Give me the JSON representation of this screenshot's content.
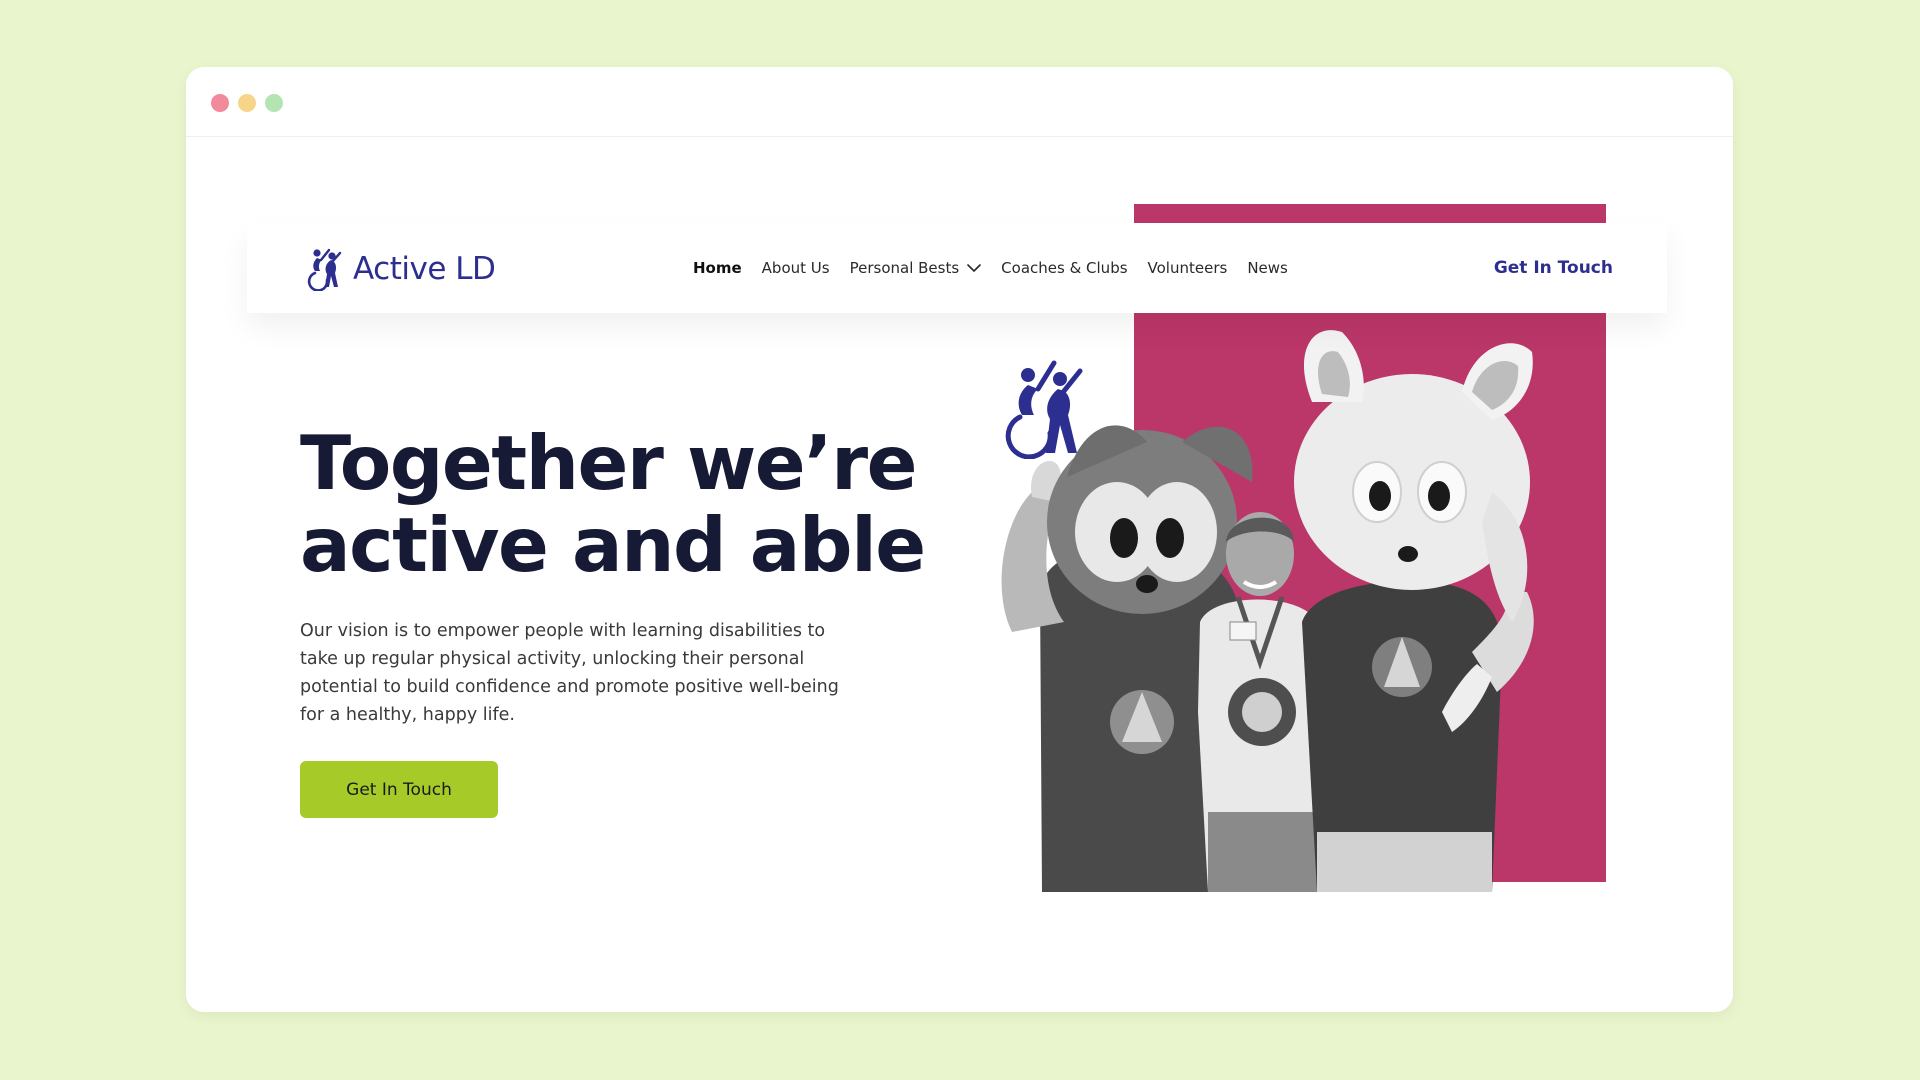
{
  "window": {
    "controls": [
      "close",
      "minimize",
      "maximize"
    ]
  },
  "brand": {
    "name": "Active LD",
    "primary_color": "#2c2f8f",
    "accent_pink": "#bb3669",
    "accent_lime": "#a6cb28",
    "logo_icon": "wheelchair-and-runner-logo-icon"
  },
  "nav": {
    "items": [
      {
        "label": "Home",
        "active": true
      },
      {
        "label": "About Us"
      },
      {
        "label": "Personal Bests",
        "has_dropdown": true
      },
      {
        "label": "Coaches & Clubs"
      },
      {
        "label": "Volunteers"
      },
      {
        "label": "News"
      }
    ],
    "cta_label": "Get In Touch"
  },
  "hero": {
    "title_line1": "Together we’re",
    "title_line2": "active and able",
    "text": "Our vision is to empower people with learning disabilities to take up regular physical activity, unlocking their personal potential to build confidence and promote positive well-being for a healthy, happy life.",
    "cta_label": "Get In Touch",
    "image": "black-and-white photo of a smiling man with a medal standing between two costumed mascots"
  }
}
